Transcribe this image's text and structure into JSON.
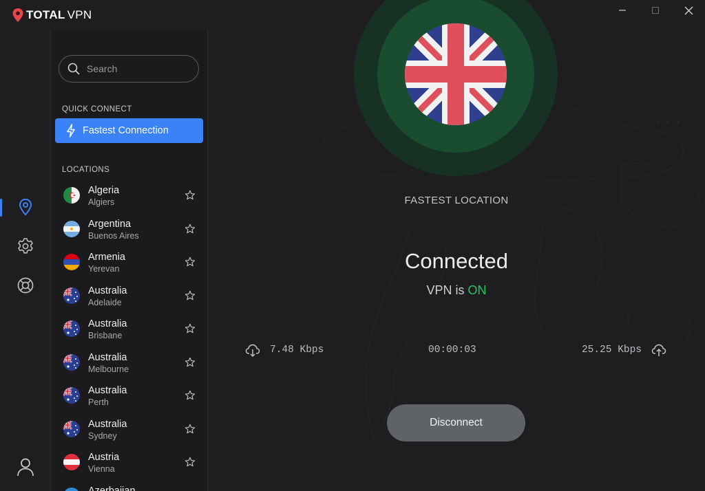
{
  "app": {
    "brand_bold": "TOTAL",
    "brand_light": "VPN",
    "window_controls": [
      "minimize",
      "maximize",
      "close"
    ]
  },
  "rail": {
    "items": [
      {
        "icon": "location-pin-icon",
        "active": true
      },
      {
        "icon": "gear-icon",
        "active": false
      },
      {
        "icon": "lifebuoy-icon",
        "active": false
      },
      {
        "icon": "user-icon",
        "active": false
      }
    ],
    "accent": "#3b82f6"
  },
  "panel": {
    "search_placeholder": "Search",
    "quick_connect_label": "QUICK CONNECT",
    "fastest_connection_label": "Fastest Connection",
    "locations_label": "LOCATIONS",
    "locations": [
      {
        "country": "Algeria",
        "city": "Algiers",
        "flag": "algeria"
      },
      {
        "country": "Argentina",
        "city": "Buenos Aires",
        "flag": "argentina"
      },
      {
        "country": "Armenia",
        "city": "Yerevan",
        "flag": "armenia"
      },
      {
        "country": "Australia",
        "city": "Adelaide",
        "flag": "australia"
      },
      {
        "country": "Australia",
        "city": "Brisbane",
        "flag": "australia"
      },
      {
        "country": "Australia",
        "city": "Melbourne",
        "flag": "australia"
      },
      {
        "country": "Australia",
        "city": "Perth",
        "flag": "australia"
      },
      {
        "country": "Australia",
        "city": "Sydney",
        "flag": "australia"
      },
      {
        "country": "Austria",
        "city": "Vienna",
        "flag": "austria"
      },
      {
        "country": "Azerbaijan",
        "city": "",
        "flag": "azerbaijan"
      }
    ]
  },
  "main": {
    "current_flag": "united-kingdom",
    "location_type": "FASTEST LOCATION",
    "status": "Connected",
    "vpn_is": "VPN is",
    "vpn_state": "ON",
    "download": "7.48 Kbps",
    "duration": "00:00:03",
    "upload": "25.25 Kbps",
    "disconnect_label": "Disconnect",
    "on_color": "#22c55e"
  }
}
